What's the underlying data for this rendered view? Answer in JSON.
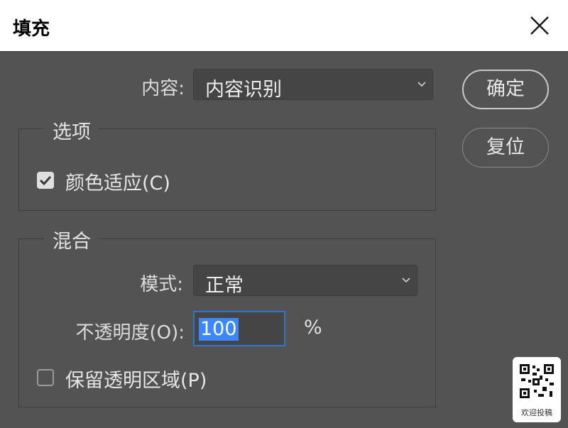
{
  "window": {
    "title": "填充"
  },
  "content_row": {
    "label": "内容:",
    "value": "内容识别"
  },
  "buttons": {
    "ok": "确定",
    "reset": "复位"
  },
  "options_group": {
    "title": "选项",
    "color_adaptation": {
      "label": "颜色适应(C)",
      "checked": true
    }
  },
  "blend_group": {
    "title": "混合",
    "mode": {
      "label": "模式:",
      "value": "正常"
    },
    "opacity": {
      "label": "不透明度(O):",
      "value": "100",
      "unit": "%"
    },
    "preserve_transparency": {
      "label": "保留透明区域(P)",
      "checked": false
    }
  },
  "corner_widget": {
    "label": "欢迎投稿",
    "icon": "qr-code-icon"
  },
  "colors": {
    "accent_focus": "#2f76d1",
    "selection": "#3a87ff",
    "panel": "#535353"
  }
}
